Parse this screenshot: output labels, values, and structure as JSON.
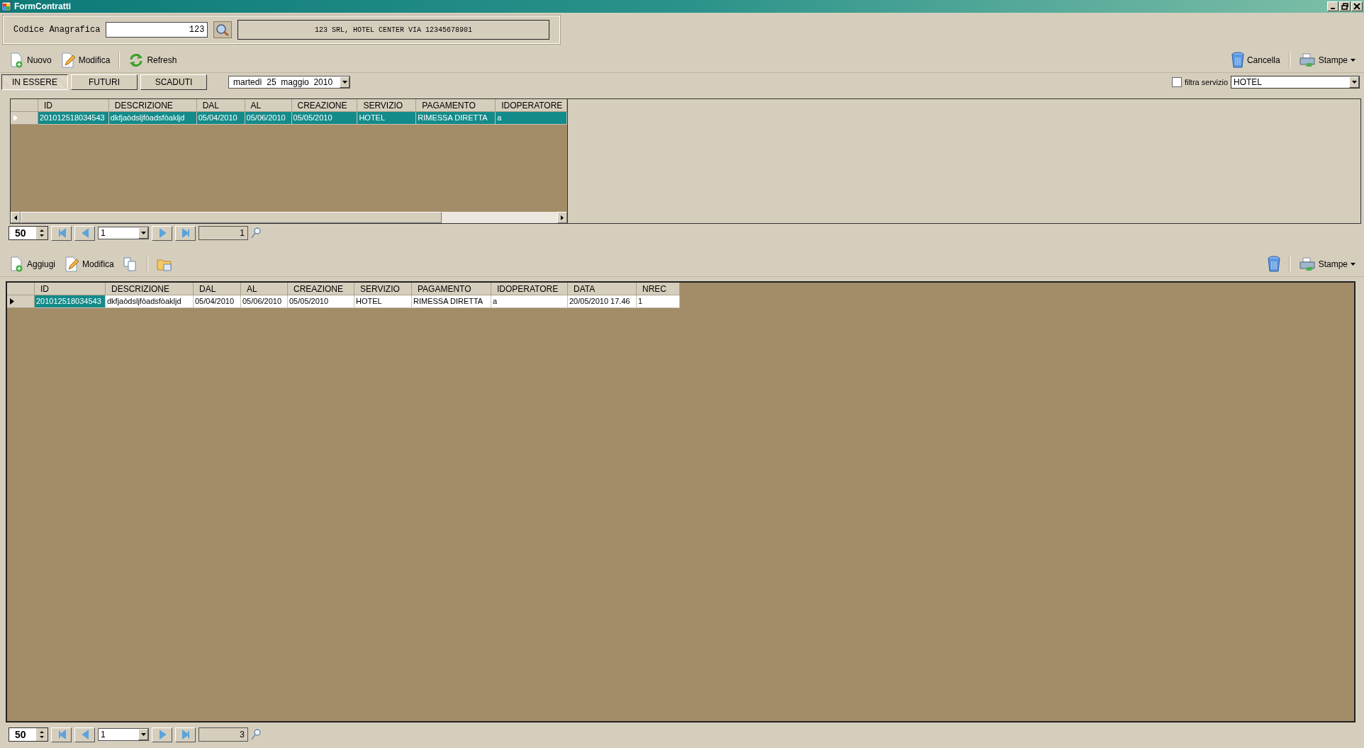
{
  "window": {
    "title": "FormContratti"
  },
  "search_panel": {
    "label": "Codice Anagrafica",
    "value": "123",
    "result": "123 SRL, HOTEL CENTER VIA 12345678901"
  },
  "toolbar": {
    "left": [
      {
        "kind": "new",
        "label": "Nuovo"
      },
      {
        "kind": "edit",
        "label": "Modifica"
      },
      {
        "kind": "refresh",
        "label": "Refresh"
      }
    ],
    "right": [
      {
        "kind": "delete",
        "label": "Cancella"
      },
      {
        "kind": "print",
        "label": "Stampe"
      }
    ]
  },
  "tabs": [
    {
      "label": "IN ESSERE",
      "selected": true
    },
    {
      "label": "FUTURI",
      "selected": false
    },
    {
      "label": "SCADUTI",
      "selected": false
    }
  ],
  "date_picker": {
    "value": "martedì  25  maggio  2010"
  },
  "filter": {
    "label": "filtra servizio",
    "checked": false,
    "value": "HOTEL"
  },
  "contracts_grid": {
    "columns": [
      "ID",
      "DESCRIZIONE",
      "DAL",
      "AL",
      "CREAZIONE",
      "SERVIZIO",
      "PAGAMENTO",
      "IDOPERATORE"
    ],
    "rows": [
      {
        "current": true,
        "cells": [
          {
            "text": "201012518034543",
            "selected": true
          },
          {
            "text": "dkfjaòdsljfòadsfòakljd",
            "selected": true
          },
          {
            "text": "05/04/2010",
            "selected": true
          },
          {
            "text": "05/06/2010",
            "selected": true
          },
          {
            "text": "05/05/2010",
            "selected": true
          },
          {
            "text": "HOTEL",
            "selected": true
          },
          {
            "text": "RIMESSA DIRETTA",
            "selected": true
          },
          {
            "text": "a",
            "selected": true
          }
        ]
      }
    ]
  },
  "contracts_pager": {
    "page_size": "50",
    "page": "1",
    "count": "1"
  },
  "detail_toolbar": {
    "left": [
      {
        "kind": "new",
        "label": "Aggiugi"
      },
      {
        "kind": "edit",
        "label": "Modifica"
      },
      {
        "kind": "copy"
      },
      {
        "kind": "folder"
      }
    ],
    "right": [
      {
        "kind": "delete"
      },
      {
        "kind": "print",
        "label": "Stampe"
      }
    ]
  },
  "detail_grid": {
    "columns": [
      "ID",
      "DESCRIZIONE",
      "DAL",
      "AL",
      "CREAZIONE",
      "SERVIZIO",
      "PAGAMENTO",
      "IDOPERATORE",
      "DATA",
      "NREC"
    ],
    "rows": [
      {
        "current": true,
        "cells": [
          {
            "text": "201012518034543",
            "selected": true
          },
          {
            "text": "dkfjaòdsljfòadsfòakljd",
            "selected": false
          },
          {
            "text": "05/04/2010",
            "selected": false
          },
          {
            "text": "05/06/2010",
            "selected": false
          },
          {
            "text": "05/05/2010",
            "selected": false
          },
          {
            "text": "HOTEL",
            "selected": false
          },
          {
            "text": "RIMESSA DIRETTA",
            "selected": false
          },
          {
            "text": "a",
            "selected": false
          },
          {
            "text": "20/05/2010 17.46",
            "selected": false
          },
          {
            "text": "1",
            "selected": false
          }
        ]
      }
    ]
  },
  "detail_pager": {
    "page_size": "50",
    "page": "1",
    "count": "3"
  }
}
